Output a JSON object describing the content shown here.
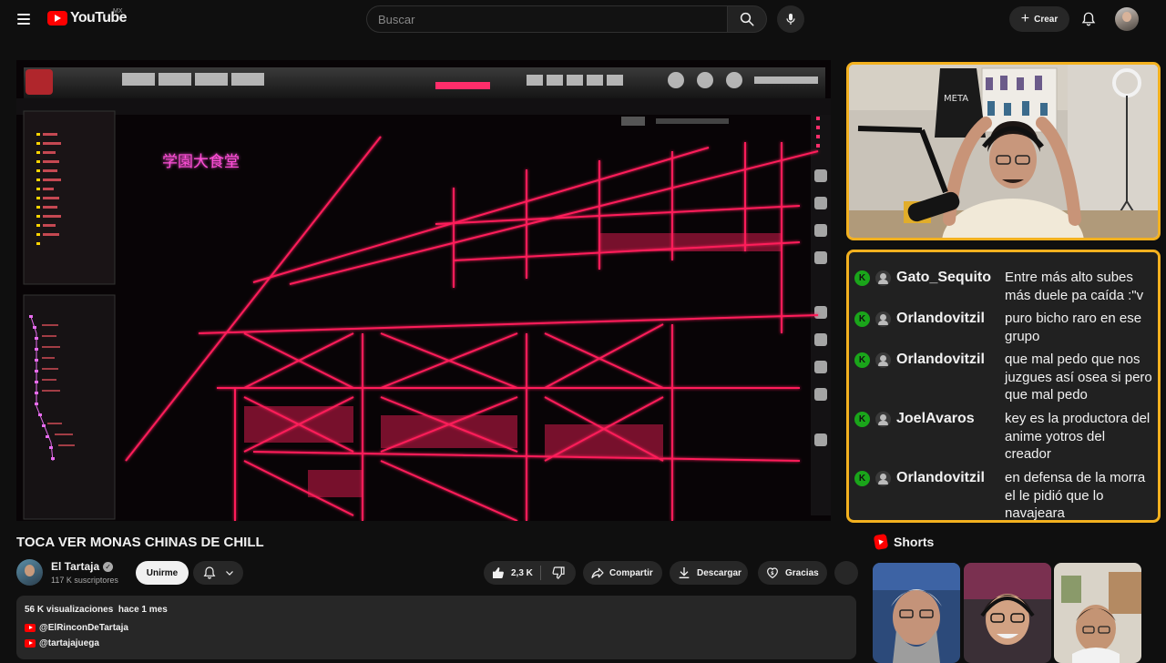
{
  "header": {
    "logo_text": "YouTube",
    "region": "MX",
    "search_placeholder": "Buscar",
    "create_label": "Crear"
  },
  "player": {
    "overlay_sign": "学園大食堂"
  },
  "chat": {
    "badge": "K",
    "messages": [
      {
        "user": "Gato_Sequito",
        "lines": [
          "Entre más alto subes",
          "más duele pa caída :\"v"
        ]
      },
      {
        "user": "Orlandovitzil",
        "lines": [
          "puro bicho raro en ese",
          "grupo"
        ]
      },
      {
        "user": "Orlandovitzil",
        "lines": [
          "que mal pedo que nos",
          "juzgues así osea si pero",
          "que mal pedo"
        ]
      },
      {
        "user": "JoelAvaros",
        "lines": [
          "key es la productora del",
          "anime yotros del",
          "creador"
        ]
      },
      {
        "user": "Orlandovitzil",
        "lines": [
          "en defensa de la morra",
          "el le pidió que lo",
          "navajeara"
        ]
      }
    ]
  },
  "video": {
    "title": "TOCA VER MONAS CHINAS DE CHILL",
    "channel_name": "El Tartaja",
    "subscribers": "117 K suscriptores",
    "join_label": "Unirme",
    "likes": "2,3 K",
    "share_label": "Compartir",
    "download_label": "Descargar",
    "thanks_label": "Gracias"
  },
  "description": {
    "views": "56 K visualizaciones",
    "date": "hace 1 mes",
    "links": [
      "@ElRinconDeTartaja",
      "@tartajajuega"
    ]
  },
  "shorts": {
    "title": "Shorts"
  }
}
